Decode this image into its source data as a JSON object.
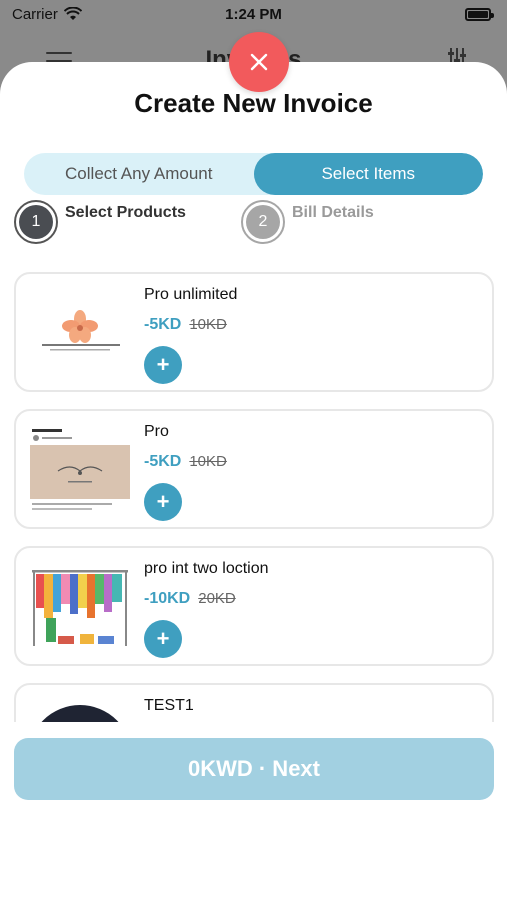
{
  "status_bar": {
    "carrier": "Carrier",
    "time": "1:24 PM"
  },
  "background_screen": {
    "title": "Invoices"
  },
  "sheet": {
    "title": "Create New Invoice",
    "segments": [
      {
        "label": "Collect Any Amount",
        "active": false
      },
      {
        "label": "Select Items",
        "active": true
      }
    ],
    "steps": [
      {
        "number": "1",
        "label": "Select Products"
      },
      {
        "number": "2",
        "label": "Bill Details"
      }
    ],
    "products": [
      {
        "name": "Pro unlimited",
        "price": "-5KD",
        "old_price": "10KD",
        "image": "flower-logo"
      },
      {
        "name": "Pro",
        "price": "-5KD",
        "old_price": "10KD",
        "image": "instagram-post"
      },
      {
        "name": "pro int two loction",
        "price": "-10KD",
        "old_price": "20KD",
        "image": "clothes-rack"
      },
      {
        "name": "TEST1",
        "price": "",
        "old_price": "",
        "image": "dark-circle"
      }
    ],
    "add_symbol": "+",
    "next_label": "0KWD · Next"
  },
  "colors": {
    "accent": "#3f9fc0",
    "segment_bg": "#daf1f8",
    "close": "#f25a5c",
    "next_disabled": "#a2d0e1"
  }
}
